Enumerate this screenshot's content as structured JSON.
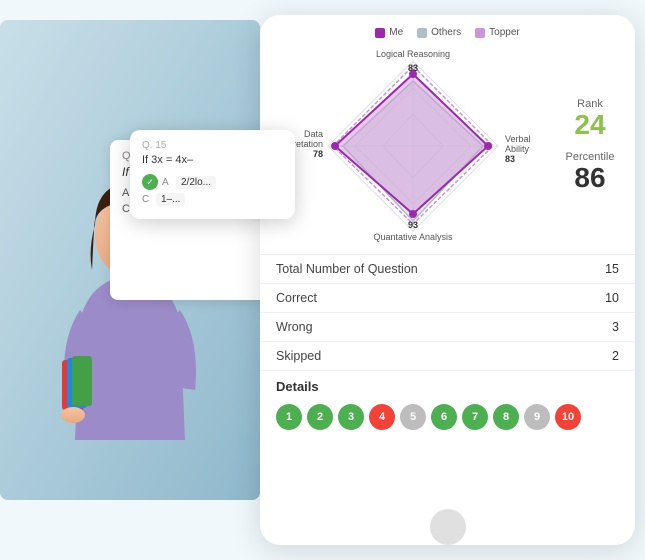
{
  "background": {
    "color": "#f0f8fb"
  },
  "legend": {
    "items": [
      {
        "label": "Me",
        "color": "#9c27b0"
      },
      {
        "label": "Others",
        "color": "#b0bec5"
      },
      {
        "label": "Topper",
        "color": "#9c27b0"
      }
    ]
  },
  "radar": {
    "axes": [
      {
        "label": "Logical Reasoning",
        "value": 83,
        "position": "top"
      },
      {
        "label": "Verbal Ability",
        "value": 83,
        "position": "right"
      },
      {
        "label": "Quantative Analysis",
        "value": 93,
        "position": "bottom"
      },
      {
        "label": "Data Interpretation",
        "value": 78,
        "position": "left"
      }
    ]
  },
  "rank": {
    "label": "Rank",
    "value": "24"
  },
  "percentile": {
    "label": "Percentile",
    "value": "86"
  },
  "stats": [
    {
      "label": "Total Number of Question",
      "value": "15"
    },
    {
      "label": "Correct",
      "value": "10"
    },
    {
      "label": "Wrong",
      "value": "3"
    },
    {
      "label": "Skipped",
      "value": "2"
    }
  ],
  "details": {
    "title": "Details",
    "bubbles": [
      {
        "num": "1",
        "type": "green"
      },
      {
        "num": "2",
        "type": "green"
      },
      {
        "num": "3",
        "type": "green"
      },
      {
        "num": "4",
        "type": "red"
      },
      {
        "num": "5",
        "type": "gray"
      },
      {
        "num": "6",
        "type": "green"
      },
      {
        "num": "7",
        "type": "green"
      },
      {
        "num": "8",
        "type": "green"
      },
      {
        "num": "9",
        "type": "gray"
      },
      {
        "num": "10",
        "type": "red"
      }
    ]
  },
  "question_card": {
    "number": "Q. 15",
    "text": "If 3x = 4x–1, then",
    "options": [
      {
        "label": "A",
        "text": "2/2lo...",
        "correct": true
      },
      {
        "label": "C",
        "text": "1–..."
      }
    ]
  },
  "question_overlay": {
    "number": "Q. 15",
    "text": "If 3x = 4x–",
    "options": [
      {
        "label": "A",
        "text": "2/2lo...",
        "correct": true
      },
      {
        "label": "C",
        "text": "1–..."
      }
    ]
  },
  "tablet": {
    "home_button_color": "#e0e0e0"
  }
}
